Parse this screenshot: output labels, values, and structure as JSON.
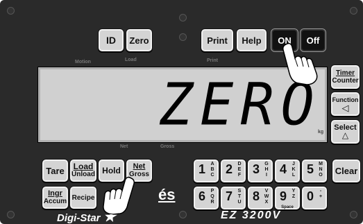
{
  "top_buttons": {
    "id": "ID",
    "zero": "Zero",
    "print": "Print",
    "help": "Help",
    "on": "ON",
    "off": "Off"
  },
  "indicator_labels": {
    "motion": "Motion",
    "load": "Load",
    "print": "Print",
    "net": "Net",
    "gross": "Gross",
    "kg": "kg"
  },
  "display": {
    "text": "ZERO"
  },
  "side_buttons": {
    "timer_line1": "Timer",
    "timer_line2": "Counter",
    "function_line1": "Function",
    "function_symbol": "◁",
    "select_line1": "Select",
    "select_symbol": "△"
  },
  "left_buttons": {
    "tare": "Tare",
    "load_line1": "Load",
    "load_line2": "Unload",
    "hold": "Hold",
    "net_line1": "Net",
    "net_line2": "Gross",
    "ingr_line1": "Ingr",
    "ingr_line2": "Accum",
    "recipe": "Recipe"
  },
  "keypad": [
    {
      "digit": "1",
      "letters": "A\nB\nC"
    },
    {
      "digit": "2",
      "letters": "D\nE\nF"
    },
    {
      "digit": "3",
      "letters": "G\nH\nI"
    },
    {
      "digit": "4",
      "letters": "J\nK\nL"
    },
    {
      "digit": "5",
      "letters": "M\nN\nO"
    },
    {
      "digit": "6",
      "letters": "P\nQ\nR"
    },
    {
      "digit": "7",
      "letters": "S\nT\nU"
    },
    {
      "digit": "8",
      "letters": "V\nW\nX"
    },
    {
      "digit": "9",
      "letters": "Y\nZ",
      "extra": "Space"
    },
    {
      "digit": "0",
      "letters": "-\n+"
    }
  ],
  "clear": "Clear",
  "connector": "és",
  "brand": "Digi-Star",
  "model": "EZ 3200V"
}
